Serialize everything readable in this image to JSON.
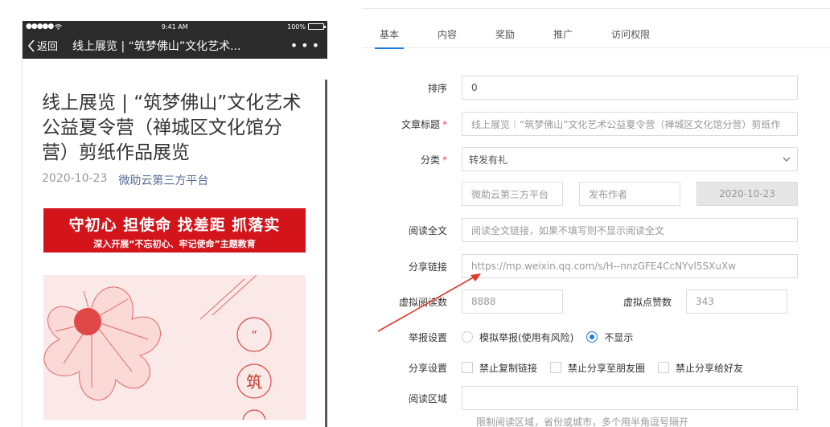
{
  "phone": {
    "status": {
      "signal": "●●●●● ",
      "time": "9:41 AM",
      "battery": "100%"
    },
    "nav": {
      "back_label": "返回",
      "title": "线上展览 | “筑梦佛山”文化艺术...",
      "more": "•••"
    },
    "article": {
      "title": "线上展览 | “筑梦佛山”文化艺术公益夏令营（禅城区文化馆分营）剪纸作品展览",
      "date": "2020-10-23",
      "source": "微助云第三方平台",
      "banner_main": "守初心 担使命 找差距 抓落实",
      "banner_sub": "深入开展“不忘初心、牢记使命”主题教育",
      "poster_char_1": "“",
      "poster_char_2": "筑"
    }
  },
  "tabs": [
    "基本",
    "内容",
    "奖励",
    "推广",
    "访问权限"
  ],
  "form": {
    "sort": {
      "label": "排序",
      "value": "0"
    },
    "title": {
      "label": "文章标题",
      "value": "线上展览｜“筑梦佛山”文化艺术公益夏令营（禅城区文化馆分营）剪纸作"
    },
    "category": {
      "label": "分类",
      "value": "转发有礼"
    },
    "source": {
      "placeholder": "微助云第三方平台"
    },
    "author": {
      "placeholder": "发布作者"
    },
    "date": {
      "value": "2020-10-23"
    },
    "read_full": {
      "label": "阅读全文",
      "placeholder": "阅读全文链接，如果不填写则不显示阅读全文"
    },
    "share_link": {
      "label": "分享链接",
      "value": "https://mp.weixin.qq.com/s/H--nnzGFE4CcNYvl5SXuXw"
    },
    "virtual_reads": {
      "label": "虚拟阅读数",
      "value": "8888"
    },
    "virtual_likes": {
      "label": "虚拟点赞数",
      "value": "343"
    },
    "report": {
      "label": "举报设置",
      "option1": "模拟举报(使用有风险)",
      "option2": "不显示"
    },
    "share_settings": {
      "label": "分享设置",
      "option1": "禁止复制链接",
      "option2": "禁止分享至朋友圈",
      "option3": "禁止分享给好友"
    },
    "read_region": {
      "label": "阅读区域",
      "hint": "限制阅读区域，省份或城市，多个用半角逗号隔开"
    }
  },
  "colors": {
    "accent": "#1c7be0",
    "required": "#e84a4a",
    "annotation_arrow": "#e03a2a",
    "banner": "#d4141b"
  }
}
